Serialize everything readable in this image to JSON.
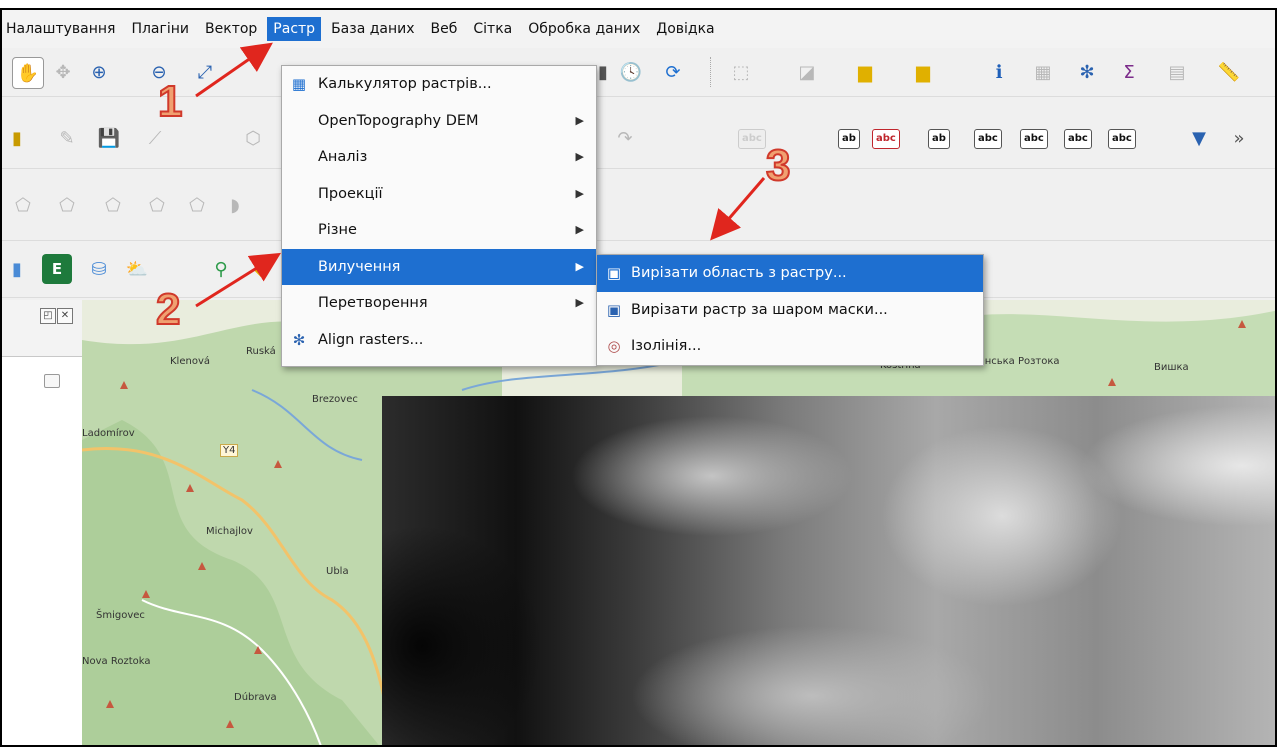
{
  "menubar": {
    "items": [
      "Налаштування",
      "Плагіни",
      "Вектор",
      "Растр",
      "База даних",
      "Веб",
      "Сітка",
      "Обробка даних",
      "Довідка"
    ],
    "active": "Растр"
  },
  "raster_menu": {
    "items": [
      {
        "label": "Калькулятор растрів...",
        "icon": "raster-calculator-icon",
        "submenu": false
      },
      {
        "label": "OpenTopography DEM",
        "icon": "",
        "submenu": true
      },
      {
        "label": "Аналіз",
        "icon": "",
        "submenu": true
      },
      {
        "label": "Проекції",
        "icon": "",
        "submenu": true
      },
      {
        "label": "Різне",
        "icon": "",
        "submenu": true
      },
      {
        "label": "Вилучення",
        "icon": "",
        "submenu": true,
        "highlighted": true
      },
      {
        "label": "Перетворення",
        "icon": "",
        "submenu": true
      },
      {
        "label": "Align rasters...",
        "icon": "gear-icon",
        "submenu": false
      }
    ]
  },
  "extraction_submenu": {
    "items": [
      {
        "label": "Вирізати область з растру...",
        "highlighted": true
      },
      {
        "label": "Вирізати растр за шаром маски..."
      },
      {
        "label": "Ізолінія..."
      }
    ]
  },
  "annotations": {
    "step1": "1",
    "step2": "2",
    "step3": "3"
  },
  "map": {
    "labels": [
      "Klenová",
      "Ruská",
      "Brezovec",
      "Ladomírov",
      "Y4",
      "Michajlov",
      "Ubla",
      "Šmigovec",
      "Nova Roztoka",
      "Dúbrava",
      "Kostrina",
      "ненська Розтока",
      "Вишка"
    ]
  },
  "colors": {
    "accent": "#1e6fd0",
    "annotation": "#d0392b"
  }
}
